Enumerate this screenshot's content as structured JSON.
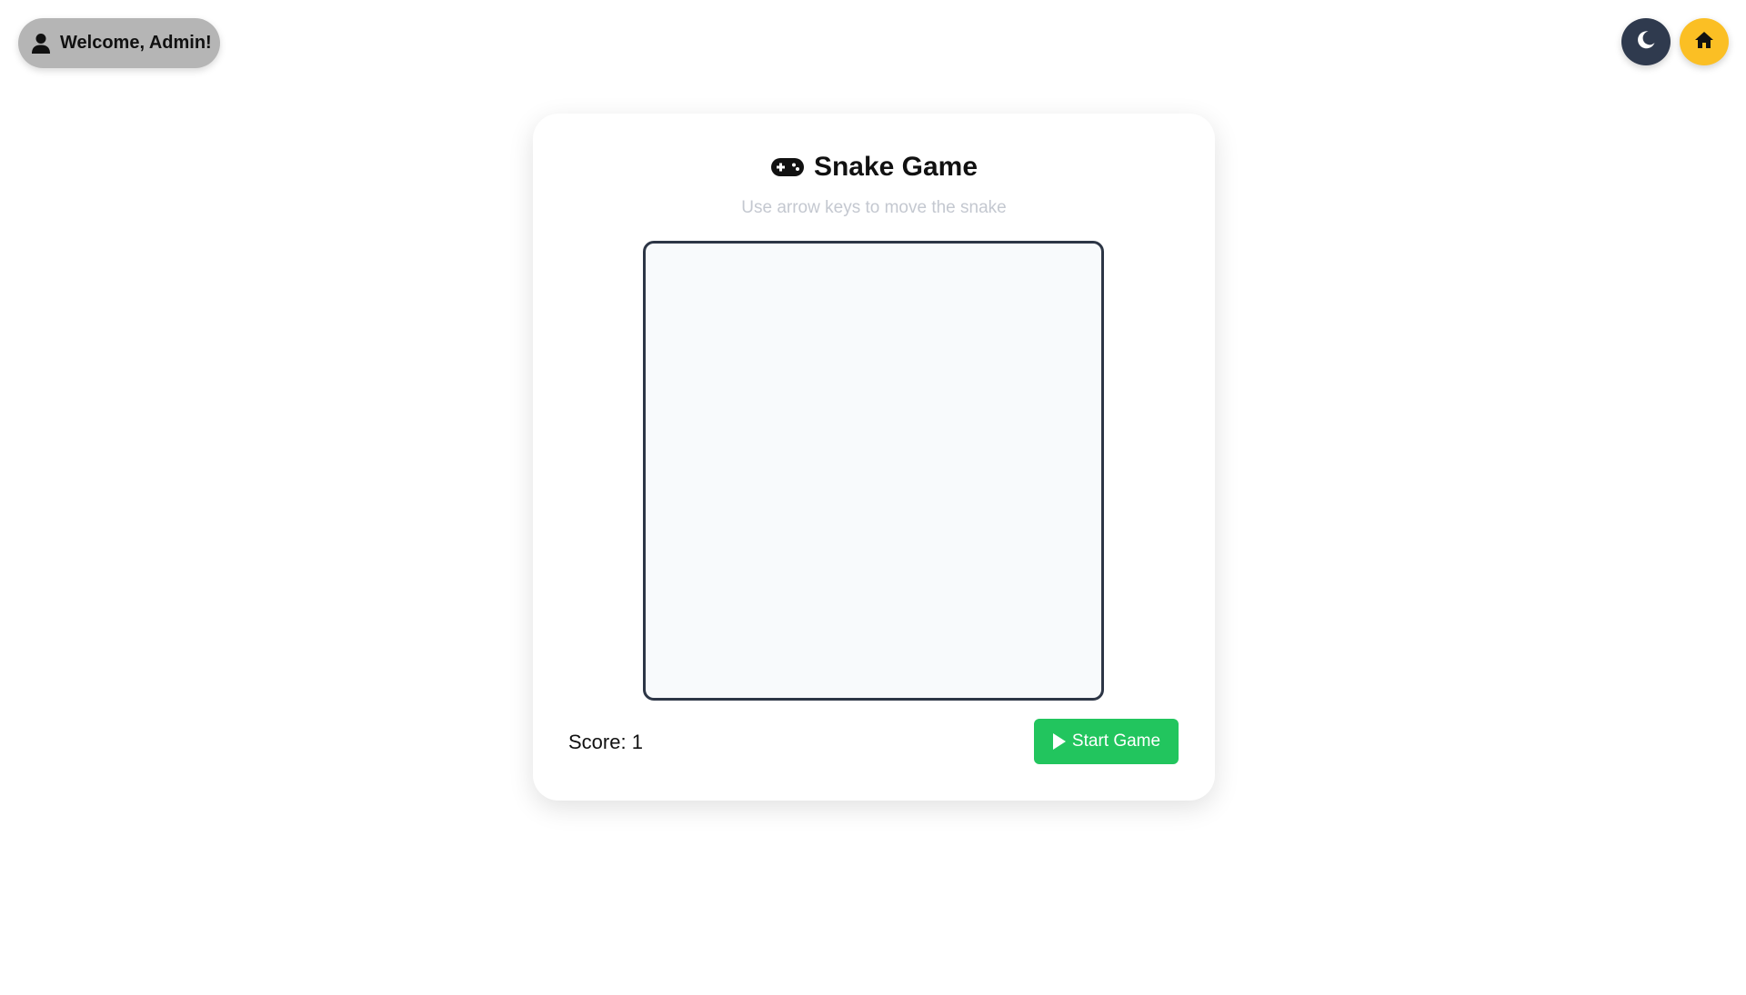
{
  "header": {
    "welcome_text": "Welcome, Admin!",
    "user_icon": "user-icon",
    "theme_toggle_icon": "moon-icon",
    "home_icon": "home-icon"
  },
  "game": {
    "title_icon": "gamepad-icon",
    "title": "Snake Game",
    "subtitle": "Use arrow keys to move the snake",
    "score_text": "Score: 1",
    "start_button_label": "Start Game",
    "start_button_icon": "play-icon"
  },
  "colors": {
    "welcome_pill": "#b5b5b5",
    "theme_button": "#2f3a4e",
    "home_button": "#fbbf24",
    "start_button": "#22c55e",
    "board_border": "#2d3646",
    "board_background": "#f8fafc",
    "subtitle": "#c4c8d0"
  }
}
